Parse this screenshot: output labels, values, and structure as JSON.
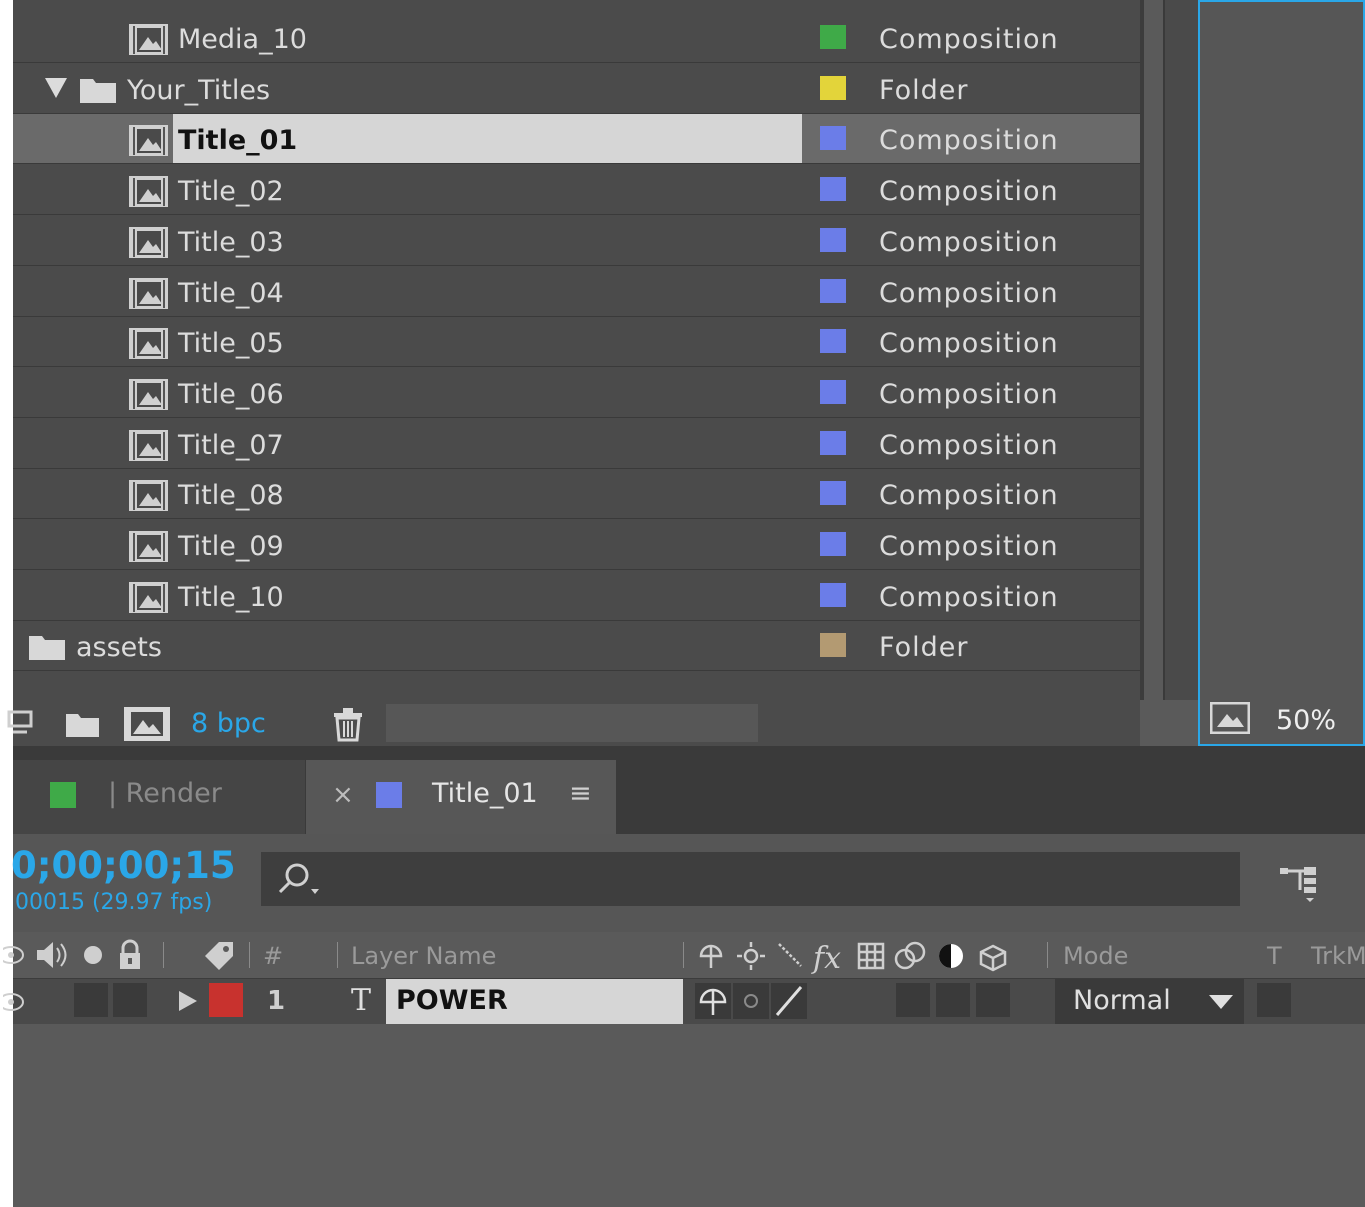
{
  "project": {
    "items": [
      {
        "name": "Media_10",
        "type": "Composition",
        "color": "#3faa48",
        "kind": "comp"
      },
      {
        "name": "Your_Titles",
        "type": "Folder",
        "color": "#e3d43a",
        "kind": "folder",
        "expanded": true
      },
      {
        "name": "Title_01",
        "type": "Composition",
        "color": "#6b7de8",
        "kind": "comp",
        "selected": true
      },
      {
        "name": "Title_02",
        "type": "Composition",
        "color": "#6b7de8",
        "kind": "comp"
      },
      {
        "name": "Title_03",
        "type": "Composition",
        "color": "#6b7de8",
        "kind": "comp"
      },
      {
        "name": "Title_04",
        "type": "Composition",
        "color": "#6b7de8",
        "kind": "comp"
      },
      {
        "name": "Title_05",
        "type": "Composition",
        "color": "#6b7de8",
        "kind": "comp"
      },
      {
        "name": "Title_06",
        "type": "Composition",
        "color": "#6b7de8",
        "kind": "comp"
      },
      {
        "name": "Title_07",
        "type": "Composition",
        "color": "#6b7de8",
        "kind": "comp"
      },
      {
        "name": "Title_08",
        "type": "Composition",
        "color": "#6b7de8",
        "kind": "comp"
      },
      {
        "name": "Title_09",
        "type": "Composition",
        "color": "#6b7de8",
        "kind": "comp"
      },
      {
        "name": "Title_10",
        "type": "Composition",
        "color": "#6b7de8",
        "kind": "comp"
      },
      {
        "name": "assets",
        "type": "Folder",
        "color": "#b39a72",
        "kind": "folder"
      }
    ],
    "footer": {
      "bpc": "8 bpc"
    }
  },
  "viewer": {
    "zoom": "50%"
  },
  "tabs": [
    {
      "label": "| Render",
      "color": "#3faa48"
    },
    {
      "label": "Title_01",
      "color": "#6b7de8",
      "close": "×",
      "menu": "≡"
    }
  ],
  "timeline": {
    "timecode": "0;00;00;15",
    "frames": "00015 (29.97 fps)",
    "columns": {
      "number": "#",
      "layer_name": "Layer Name",
      "mode": "Mode",
      "t": "T",
      "trkmat": "TrkM"
    },
    "layer": {
      "index": "1",
      "type_glyph": "T",
      "name": "POWER",
      "label_color": "#c8322e",
      "mode": "Normal"
    }
  },
  "colors": {
    "accent": "#2aa7e8"
  }
}
